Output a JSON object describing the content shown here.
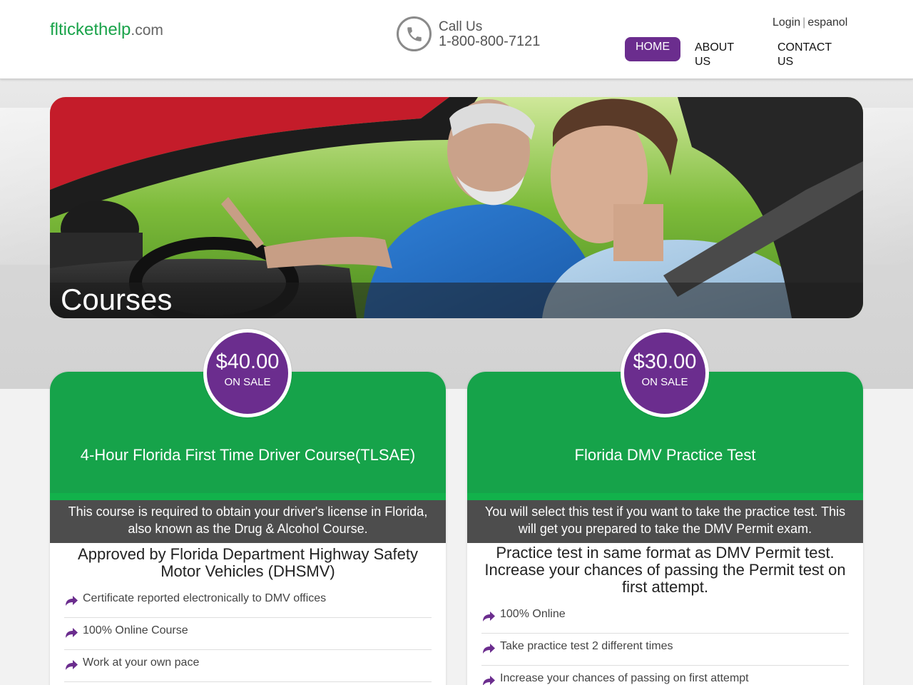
{
  "header": {
    "logo_brand": "flticket help",
    "logo_brand_text": "flticket",
    "logo_brand_text2": "help",
    "logo_tld": ".com",
    "call_label": "Call Us",
    "call_number": "1-800-800-7121",
    "login": "Login",
    "separator": "|",
    "espanol": "espanol"
  },
  "nav": {
    "items": [
      {
        "label": "HOME",
        "active": true
      },
      {
        "label": "ABOUT US",
        "active": false
      },
      {
        "label": "CONTACT US",
        "active": false
      }
    ]
  },
  "hero": {
    "caption": "Courses"
  },
  "courses": [
    {
      "price": "$40.00",
      "sale": "ON SALE",
      "title": "4-Hour Florida First Time Driver Course(TLSAE)",
      "description": "This course is required to obtain your driver's license in Florida, also known as the Drug & Alcohol Course.",
      "headline": "Approved by Florida Department Highway Safety Motor Vehicles (DHSMV)",
      "features": [
        "Certificate reported electronically to DMV offices",
        "100% Online Course",
        "Work at your own pace"
      ]
    },
    {
      "price": "$30.00",
      "sale": "ON SALE",
      "title": "Florida DMV Practice Test",
      "description": "You will select this test if you want to take the practice test. This will get you prepared to take the DMV Permit exam.",
      "headline": "Practice test in same format as DMV Permit test. Increase your chances of passing the Permit test on first attempt.",
      "features": [
        "100% Online",
        "Take practice test 2 different times",
        "Increase your chances of passing on first attempt"
      ]
    }
  ],
  "colors": {
    "brand_green": "#1aa34a",
    "card_green": "#16a34a",
    "accent_purple": "#6b2d8e",
    "desc_gray": "#4d4d4d"
  },
  "icons": {
    "phone": "phone-icon",
    "feature_bullet": "arrow-right-icon"
  }
}
